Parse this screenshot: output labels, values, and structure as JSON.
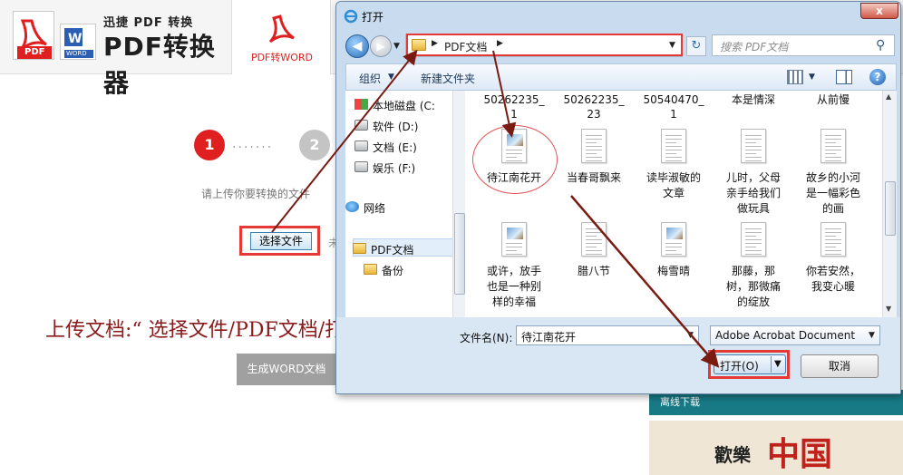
{
  "app": {
    "logo_subtitle": "迅捷 PDF 转换",
    "logo_title": "PDF转换器",
    "logo_pdf_tag": "PDF",
    "logo_word_tag": "WORD",
    "active_tab": "PDF转WORD"
  },
  "steps": {
    "step1": "1",
    "step2": "2",
    "dots": "·······"
  },
  "upload": {
    "hint": "请上传你要转换的文件",
    "choose_button": "选择文件",
    "choose_trail": "未选"
  },
  "caption": "上传文档:“ 选择文件/PDF文档/打开 ”",
  "generate_button": "生成WORD文档",
  "side_panel": {
    "header": "离线下载",
    "banner_text": "歡樂",
    "seal_text": "中国"
  },
  "dialog": {
    "title": "打开",
    "close": "x",
    "address_path": "PDF文档",
    "search_placeholder": "搜索 PDF文档",
    "toolbar": {
      "organize": "组织",
      "new_folder": "新建文件夹"
    },
    "nav_items": [
      {
        "label": "本地磁盘 (C:",
        "icon": "drive-c-icon"
      },
      {
        "label": "软件 (D:)",
        "icon": "drive-icon"
      },
      {
        "label": "文档 (E:)",
        "icon": "drive-icon"
      },
      {
        "label": "娱乐 (F:)",
        "icon": "drive-icon"
      },
      {
        "label": "网络",
        "icon": "network-icon"
      },
      {
        "label": "PDF文档",
        "icon": "folder-icon"
      },
      {
        "label": "备份",
        "icon": "folder-icon"
      }
    ],
    "top_row": [
      {
        "line1": "50262235_",
        "line2": "1"
      },
      {
        "line1": "50262235_",
        "line2": "23"
      },
      {
        "line1": "50540470_",
        "line2": "1"
      },
      {
        "line1": "本是情深",
        "line2": ""
      },
      {
        "line1": "从前慢",
        "line2": ""
      }
    ],
    "row1": [
      {
        "lines": [
          "待江南花开"
        ],
        "pic": true
      },
      {
        "lines": [
          "当春哥飘来"
        ],
        "pic": false
      },
      {
        "lines": [
          "读毕淑敏的",
          "文章"
        ],
        "pic": false
      },
      {
        "lines": [
          "儿时，父母",
          "亲手给我们",
          "做玩具"
        ],
        "pic": false
      },
      {
        "lines": [
          "故乡的小河",
          "是一幅彩色",
          "的画"
        ],
        "pic": false
      }
    ],
    "row2": [
      {
        "lines": [
          "或许，放手",
          "也是一种别",
          "样的幸福"
        ],
        "pic": true
      },
      {
        "lines": [
          "腊八节"
        ],
        "pic": false
      },
      {
        "lines": [
          "梅雪晴"
        ],
        "pic": true
      },
      {
        "lines": [
          "那藤，那",
          "树，那微痛",
          "的绽放"
        ],
        "pic": false
      },
      {
        "lines": [
          "你若安然，",
          "我变心暖"
        ],
        "pic": false
      }
    ],
    "filename_label": "文件名(N):",
    "filename_value": "待江南花开",
    "filetype_value": "Adobe Acrobat Document",
    "open_button": "打开(O)",
    "cancel_button": "取消"
  },
  "colors": {
    "accent_red": "#e53935",
    "caption_red": "#8b1a1a",
    "dialog_frame": "#c9dbef",
    "teal": "#177a85"
  }
}
